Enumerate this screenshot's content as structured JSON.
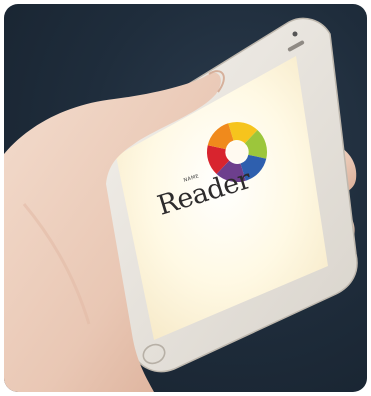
{
  "app": {
    "name": "Reader",
    "tagline": "NAME"
  },
  "colors": {
    "background": "#1f2d3c",
    "phone_body": "#ebe7e1",
    "screen_glow": "#fff8d8",
    "logo_orange": "#f08a1c",
    "logo_yellow": "#f6c41d",
    "logo_blue": "#2e5fae",
    "logo_purple": "#6d3f8d"
  },
  "icons": [
    "app-logo-icon",
    "home-button-icon",
    "earpiece-icon",
    "camera-icon"
  ]
}
